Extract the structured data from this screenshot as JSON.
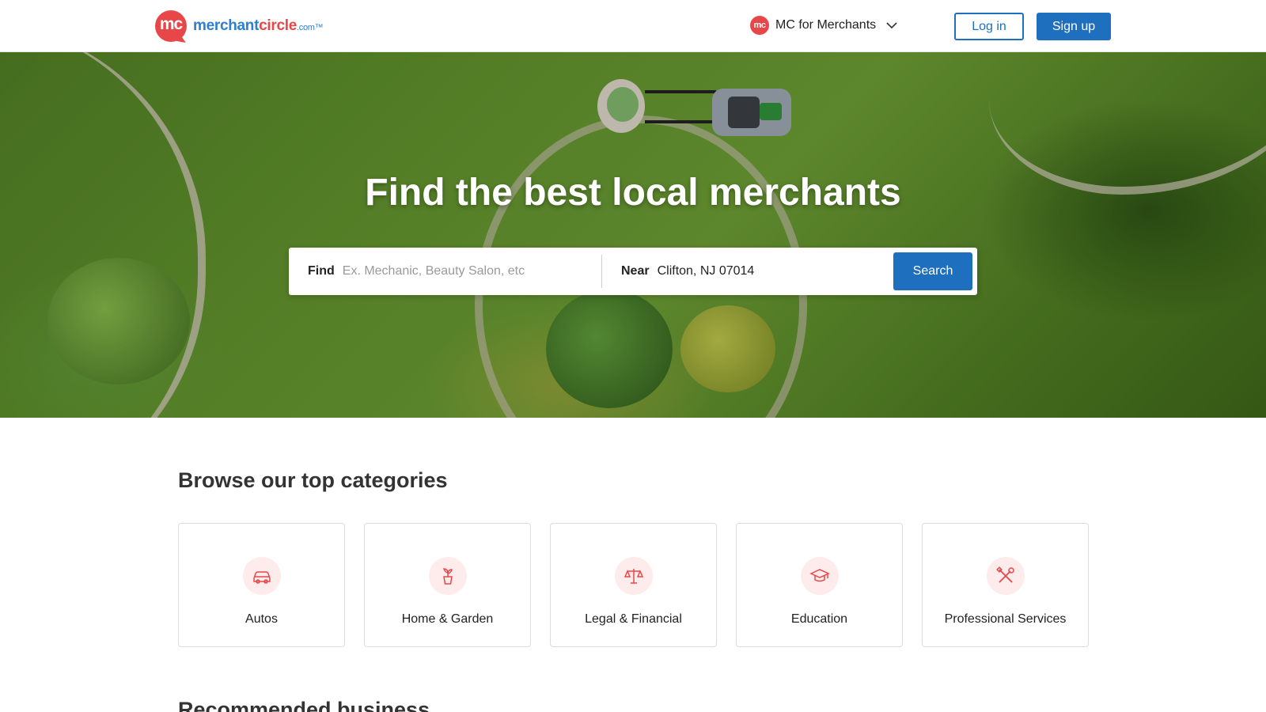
{
  "header": {
    "logo_mark": "mc",
    "logo_word_1": "merchant",
    "logo_word_2": "circle",
    "logo_word_3": ".com™",
    "merchants_badge": "mc",
    "merchants_label": "MC for Merchants",
    "login_label": "Log in",
    "signup_label": "Sign up"
  },
  "hero": {
    "title": "Find the best local merchants",
    "find_label": "Find",
    "find_placeholder": "Ex. Mechanic, Beauty Salon, etc",
    "near_label": "Near",
    "near_value": "Clifton, NJ 07014",
    "search_label": "Search"
  },
  "categories": {
    "title": "Browse our top categories",
    "items": [
      {
        "label": "Autos",
        "icon": "car-icon"
      },
      {
        "label": "Home & Garden",
        "icon": "potted-plant-icon"
      },
      {
        "label": "Legal & Financial",
        "icon": "scales-icon"
      },
      {
        "label": "Education",
        "icon": "graduation-cap-icon"
      },
      {
        "label": "Professional Services",
        "icon": "tools-icon"
      }
    ]
  },
  "recommended": {
    "title": "Recommended business"
  },
  "colors": {
    "brand_red": "#e8474a",
    "brand_blue": "#1f6fbf",
    "icon_bg": "#fdeceb"
  }
}
